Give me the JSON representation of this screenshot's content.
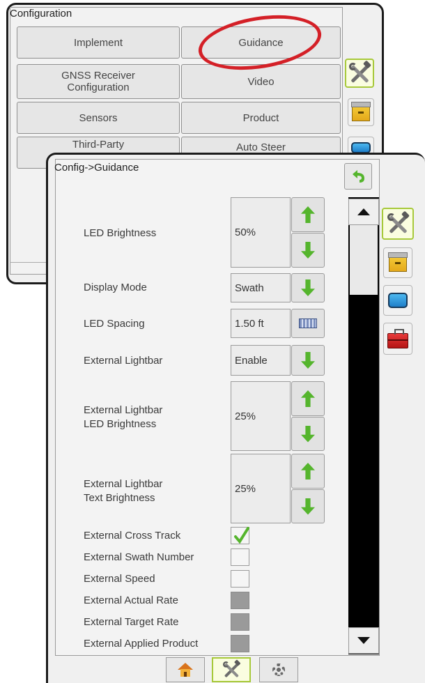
{
  "back_panel": {
    "title": "Configuration",
    "buttons": [
      {
        "label": "Implement"
      },
      {
        "label": "Guidance"
      },
      {
        "label": "GNSS Receiver\nConfiguration"
      },
      {
        "label": "Video"
      },
      {
        "label": "Sensors"
      },
      {
        "label": "Product"
      },
      {
        "label": "Third-Party"
      },
      {
        "label": "Auto Steer"
      }
    ]
  },
  "front_panel": {
    "title": "Config->Guidance",
    "settings": {
      "led_brightness": {
        "label": "LED Brightness",
        "value": "50%"
      },
      "display_mode": {
        "label": "Display Mode",
        "value": "Swath"
      },
      "led_spacing": {
        "label": "LED Spacing",
        "value": "1.50 ft"
      },
      "external_lightbar": {
        "label": "External Lightbar",
        "value": "Enable"
      },
      "ext_lightbar_led_brightness": {
        "label": "External Lightbar\nLED Brightness",
        "value": "25%"
      },
      "ext_lightbar_text_brightness": {
        "label": "External Lightbar\nText Brightness",
        "value": "25%"
      }
    },
    "checkboxes": [
      {
        "label": "External Cross Track",
        "checked": true,
        "enabled": true
      },
      {
        "label": "External Swath Number",
        "checked": false,
        "enabled": true
      },
      {
        "label": "External Speed",
        "checked": false,
        "enabled": true
      },
      {
        "label": "External Actual Rate",
        "checked": false,
        "enabled": false
      },
      {
        "label": "External Target Rate",
        "checked": false,
        "enabled": false
      },
      {
        "label": "External Applied Product",
        "checked": false,
        "enabled": false
      }
    ]
  },
  "side_tabs": [
    "tools-icon",
    "cabinet-icon",
    "screen-icon",
    "toolbox-icon"
  ],
  "bottom_nav": [
    "home-icon",
    "tools-icon",
    "gear-icon"
  ],
  "colors": {
    "accent_green": "#55b52d",
    "highlight_red": "#d42027",
    "active_tab_border": "#a7c93a"
  }
}
